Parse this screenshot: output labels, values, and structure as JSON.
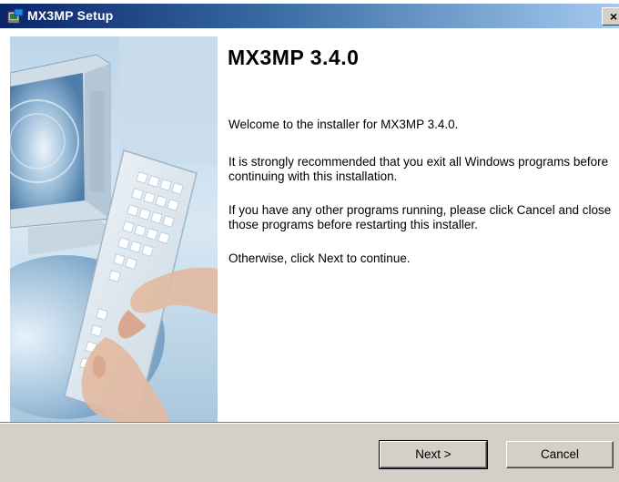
{
  "window": {
    "title": "MX3MP Setup",
    "close_label": "×",
    "icon": "installer-icon"
  },
  "main": {
    "heading": "MX3MP 3.4.0",
    "welcome": "Welcome to the installer for MX3MP 3.4.0.",
    "recommend": "It is strongly recommended that you exit all Windows programs before continuing with this installation.",
    "running": "If you have any other programs running, please click Cancel and close those programs before restarting this installer.",
    "otherwise": "Otherwise, click Next to continue."
  },
  "buttons": {
    "next": "Next >",
    "cancel": "Cancel"
  },
  "colors": {
    "titlebar_start": "#0a246a",
    "titlebar_end": "#a6caf0",
    "dialog_bg": "#d4d0c8"
  }
}
